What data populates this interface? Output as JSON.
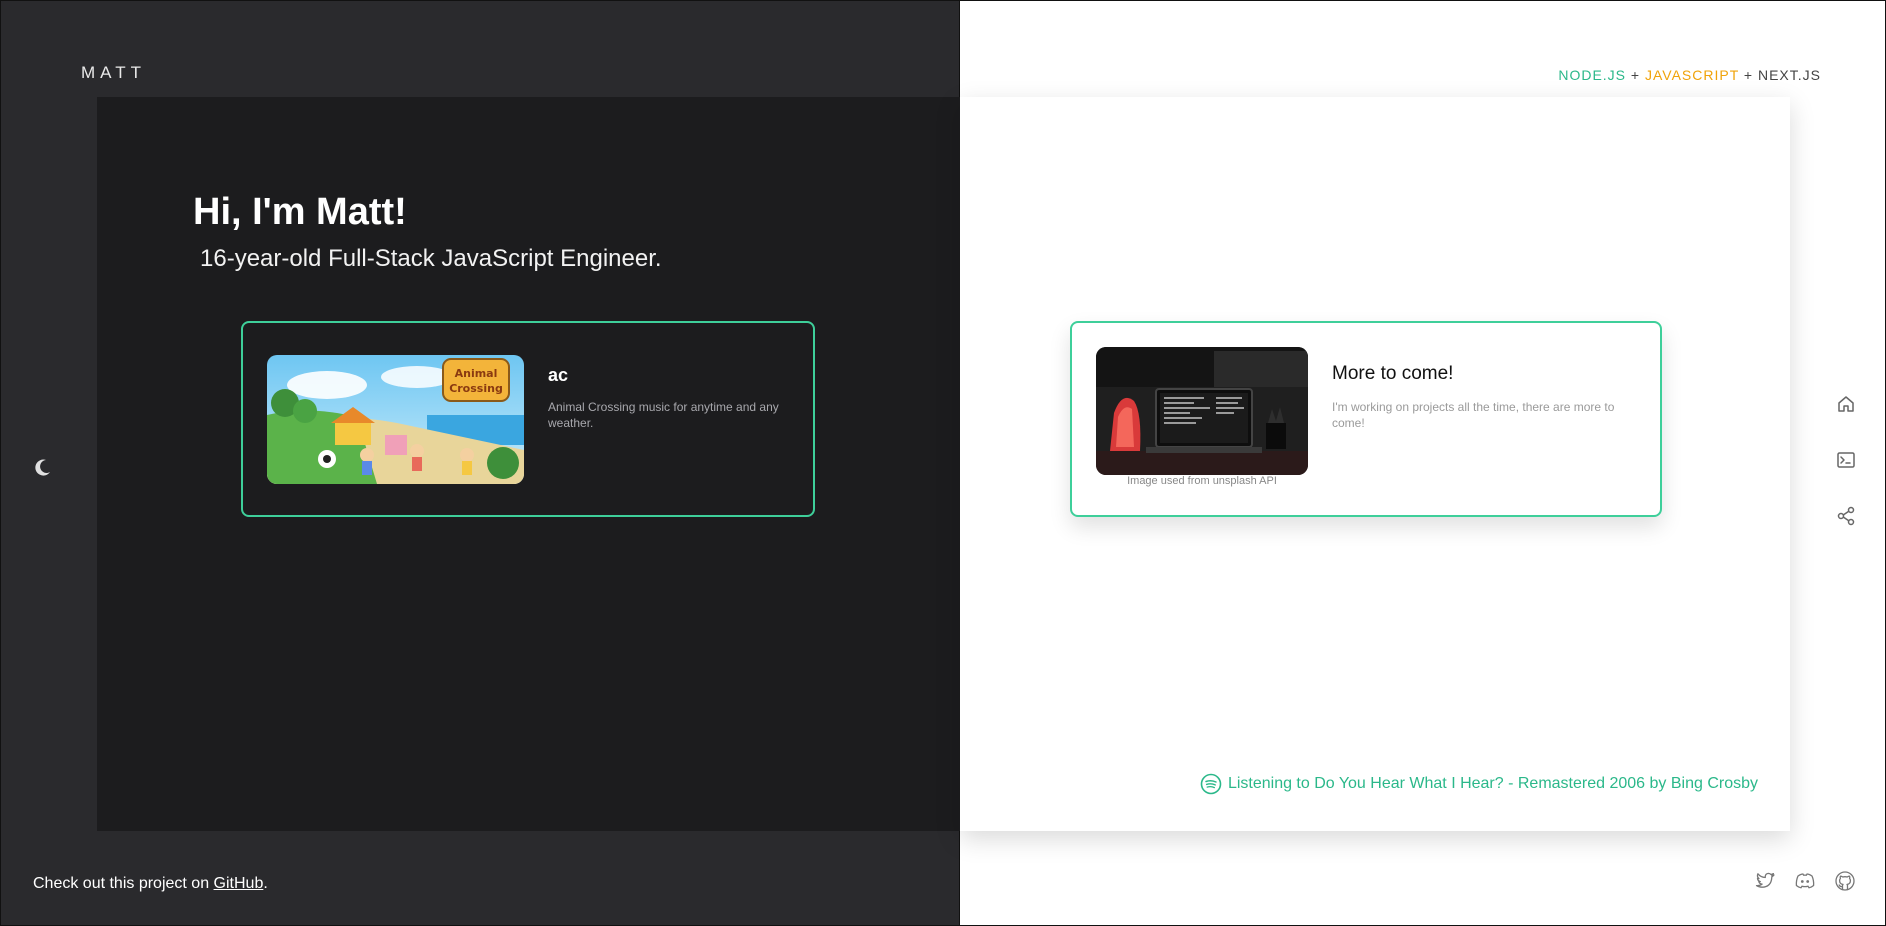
{
  "left": {
    "brand": "MATT",
    "hero_title": "Hi, I'm Matt!",
    "hero_subtitle": "16-year-old Full-Stack JavaScript Engineer.",
    "project_card": {
      "title": "ac",
      "description": "Animal Crossing music for anytime and any weather.",
      "image_logo_text": "Animal Crossing"
    },
    "footer": {
      "text": "Check out this project on ",
      "link": "GitHub",
      "suffix": "."
    }
  },
  "right": {
    "stack": {
      "node": "NODE.JS",
      "plus1": "+",
      "js": "JAVASCRIPT",
      "plus2": "+",
      "next": "NEXT.JS"
    },
    "project_card": {
      "title": "More to come!",
      "description": "I'm working on projects all the time, there are more to come!",
      "image_credit": "Image used from unsplash API"
    },
    "now_playing": "Listening to Do You Hear What I Hear? - Remastered 2006 by Bing Crosby",
    "side_nav": [
      "home-icon",
      "terminal-icon",
      "share-icon"
    ],
    "socials": [
      "twitter-icon",
      "discord-icon",
      "github-icon"
    ]
  },
  "colors": {
    "accent": "#3ecf9a",
    "accent_text": "#2bb88a",
    "js": "#f0a30a",
    "dark_bg": "#2a2a2d",
    "dark_panel": "#1c1c1e"
  }
}
